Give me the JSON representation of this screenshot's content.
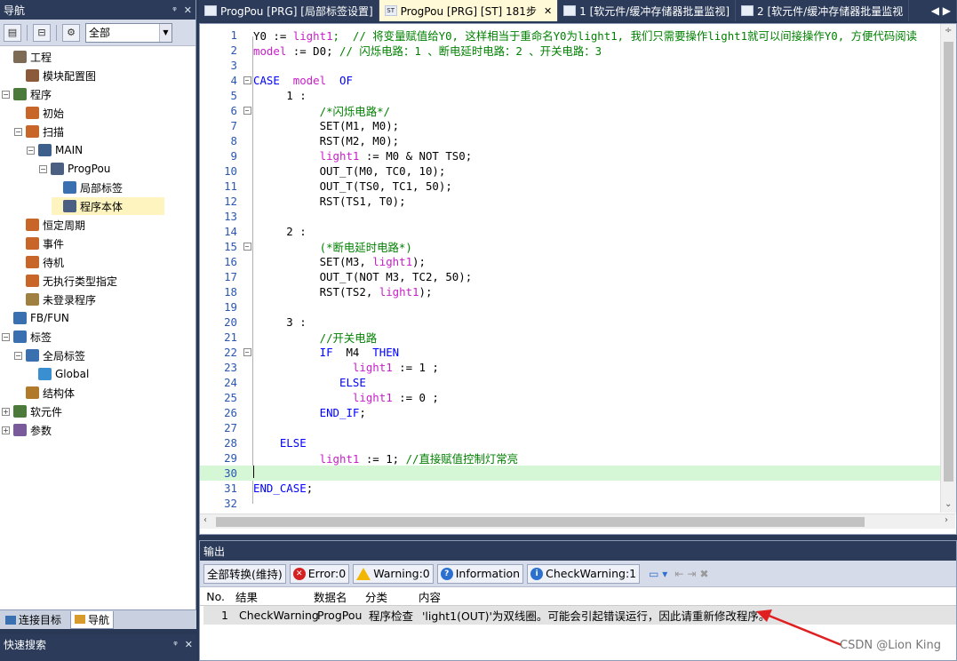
{
  "nav": {
    "title": "导航",
    "pin": "ᵠ",
    "close": "✕",
    "filter_value": "全部",
    "tree": [
      {
        "label": "工程",
        "indent": 0,
        "toggle": "",
        "icon": "project-icon",
        "iconColor": "#7d6b55"
      },
      {
        "label": "模块配置图",
        "indent": 1,
        "toggle": "",
        "icon": "module-config-icon",
        "iconColor": "#8a5a3a"
      },
      {
        "label": "程序",
        "indent": 0,
        "toggle": "−",
        "icon": "program-folder-icon",
        "iconColor": "#4b7a3a"
      },
      {
        "label": "初始",
        "indent": 1,
        "toggle": "",
        "icon": "program-icon",
        "iconColor": "#c8662a"
      },
      {
        "label": "扫描",
        "indent": 1,
        "toggle": "−",
        "icon": "program-icon",
        "iconColor": "#c8662a"
      },
      {
        "label": "MAIN",
        "indent": 2,
        "toggle": "−",
        "icon": "main-icon",
        "iconColor": "#3c5f8c"
      },
      {
        "label": "ProgPou",
        "indent": 3,
        "toggle": "−",
        "icon": "st-icon",
        "iconColor": "#4a5f82"
      },
      {
        "label": "局部标签",
        "indent": 4,
        "toggle": "",
        "icon": "local-label-icon",
        "iconColor": "#3a6fb0"
      },
      {
        "label": "程序本体",
        "indent": 4,
        "toggle": "",
        "icon": "st-body-icon",
        "iconColor": "#4a5f82"
      },
      {
        "label": "恒定周期",
        "indent": 1,
        "toggle": "",
        "icon": "program-icon",
        "iconColor": "#c8662a"
      },
      {
        "label": "事件",
        "indent": 1,
        "toggle": "",
        "icon": "program-icon",
        "iconColor": "#c8662a"
      },
      {
        "label": "待机",
        "indent": 1,
        "toggle": "",
        "icon": "program-icon",
        "iconColor": "#c8662a"
      },
      {
        "label": "无执行类型指定",
        "indent": 1,
        "toggle": "",
        "icon": "program-icon",
        "iconColor": "#c8662a"
      },
      {
        "label": "未登录程序",
        "indent": 1,
        "toggle": "",
        "icon": "unregistered-icon",
        "iconColor": "#a08040"
      },
      {
        "label": "FB/FUN",
        "indent": 0,
        "toggle": "",
        "icon": "fbfun-icon",
        "iconColor": "#3a6fb0"
      },
      {
        "label": "标签",
        "indent": 0,
        "toggle": "−",
        "icon": "label-folder-icon",
        "iconColor": "#3a6fb0"
      },
      {
        "label": "全局标签",
        "indent": 1,
        "toggle": "−",
        "icon": "global-label-icon",
        "iconColor": "#3a6fb0"
      },
      {
        "label": "Global",
        "indent": 2,
        "toggle": "",
        "icon": "global-icon",
        "iconColor": "#3a8fd0"
      },
      {
        "label": "结构体",
        "indent": 1,
        "toggle": "",
        "icon": "struct-icon",
        "iconColor": "#b07a2a"
      },
      {
        "label": "软元件",
        "indent": 0,
        "toggle": "+",
        "icon": "device-icon",
        "iconColor": "#4b7a3a"
      },
      {
        "label": "参数",
        "indent": 0,
        "toggle": "+",
        "icon": "parameter-icon",
        "iconColor": "#7a5a9a"
      }
    ],
    "selected_index": 8,
    "bottom_tabs": [
      "连接目标",
      "导航"
    ],
    "quick_search": "快速搜索"
  },
  "tabs": [
    {
      "label": "ProgPou [PRG] [局部标签设置]",
      "icon": "local-label-icon",
      "active": false,
      "close": false
    },
    {
      "label": "ProgPou [PRG] [ST] 181步",
      "icon": "st-icon",
      "active": true,
      "close": true
    },
    {
      "label": "1 [软元件/缓冲存储器批量监视]",
      "icon": "monitor-icon",
      "active": false,
      "close": false
    },
    {
      "label": "2 [软元件/缓冲存储器批量监视",
      "icon": "monitor-icon",
      "active": false,
      "close": false
    }
  ],
  "tab_scroll": "◀ ▶",
  "editor": {
    "highlight_line": 30,
    "lines": [
      {
        "n": "1",
        "fold": "",
        "parts": [
          [
            "Y0 := ",
            ""
          ],
          [
            "light1",
            "var"
          ],
          [
            ";  // 将变量赋值给Y0, 这样相当于重命名Y0为light1, 我们只需要操作light1就可以间接操作Y0, 方便代码阅读",
            "cm"
          ]
        ]
      },
      {
        "n": "2",
        "fold": "",
        "parts": [
          [
            "model",
            "var"
          ],
          [
            " := D0; ",
            ""
          ],
          [
            "// 闪烁电路：1 、断电延时电路：2 、开关电路：3",
            "cm"
          ]
        ]
      },
      {
        "n": "3",
        "fold": "",
        "parts": []
      },
      {
        "n": "4",
        "fold": "−",
        "parts": [
          [
            "CASE",
            "kw"
          ],
          [
            "  ",
            ""
          ],
          [
            "model",
            "var"
          ],
          [
            "  ",
            ""
          ],
          [
            "OF",
            "kw"
          ]
        ]
      },
      {
        "n": "5",
        "fold": "",
        "parts": [
          [
            "     1 :",
            ""
          ]
        ]
      },
      {
        "n": "6",
        "fold": "−",
        "parts": [
          [
            "          ",
            ""
          ],
          [
            "/*闪烁电路*/",
            "cm"
          ]
        ]
      },
      {
        "n": "7",
        "fold": "",
        "parts": [
          [
            "          SET(M1, M0);",
            ""
          ]
        ]
      },
      {
        "n": "8",
        "fold": "",
        "parts": [
          [
            "          RST(M2, M0);",
            ""
          ]
        ]
      },
      {
        "n": "9",
        "fold": "",
        "parts": [
          [
            "          ",
            ""
          ],
          [
            "light1",
            "var"
          ],
          [
            " := M0 & NOT TS0;",
            ""
          ]
        ]
      },
      {
        "n": "10",
        "fold": "",
        "parts": [
          [
            "          OUT_T(M0, TC0, 10);",
            ""
          ]
        ]
      },
      {
        "n": "11",
        "fold": "",
        "parts": [
          [
            "          OUT_T(TS0, TC1, 50);",
            ""
          ]
        ]
      },
      {
        "n": "12",
        "fold": "",
        "parts": [
          [
            "          RST(TS1, T0);",
            ""
          ]
        ]
      },
      {
        "n": "13",
        "fold": "",
        "parts": []
      },
      {
        "n": "14",
        "fold": "",
        "parts": [
          [
            "     2 :",
            ""
          ]
        ]
      },
      {
        "n": "15",
        "fold": "−",
        "parts": [
          [
            "          ",
            ""
          ],
          [
            "(*断电延时电路*)",
            "cm"
          ]
        ]
      },
      {
        "n": "16",
        "fold": "",
        "parts": [
          [
            "          SET(M3, ",
            ""
          ],
          [
            "light1",
            "var"
          ],
          [
            ");",
            ""
          ]
        ]
      },
      {
        "n": "17",
        "fold": "",
        "parts": [
          [
            "          OUT_T(NOT M3, TC2, 50);",
            ""
          ]
        ]
      },
      {
        "n": "18",
        "fold": "",
        "parts": [
          [
            "          RST(TS2, ",
            ""
          ],
          [
            "light1",
            "var"
          ],
          [
            ");",
            ""
          ]
        ]
      },
      {
        "n": "19",
        "fold": "",
        "parts": []
      },
      {
        "n": "20",
        "fold": "",
        "parts": [
          [
            "     3 :",
            ""
          ]
        ]
      },
      {
        "n": "21",
        "fold": "",
        "parts": [
          [
            "          ",
            ""
          ],
          [
            "//开关电路",
            "cm"
          ]
        ]
      },
      {
        "n": "22",
        "fold": "−",
        "parts": [
          [
            "          ",
            ""
          ],
          [
            "IF",
            "kw"
          ],
          [
            "  M4  ",
            ""
          ],
          [
            "THEN",
            "kw"
          ]
        ]
      },
      {
        "n": "23",
        "fold": "",
        "parts": [
          [
            "               ",
            ""
          ],
          [
            "light1",
            "var"
          ],
          [
            " := 1 ;",
            ""
          ]
        ]
      },
      {
        "n": "24",
        "fold": "",
        "parts": [
          [
            "             ",
            ""
          ],
          [
            "ELSE",
            "kw"
          ]
        ]
      },
      {
        "n": "25",
        "fold": "",
        "parts": [
          [
            "               ",
            ""
          ],
          [
            "light1",
            "var"
          ],
          [
            " := 0 ;",
            ""
          ]
        ]
      },
      {
        "n": "26",
        "fold": "",
        "parts": [
          [
            "          ",
            ""
          ],
          [
            "END_IF",
            "kw"
          ],
          [
            ";",
            ""
          ]
        ]
      },
      {
        "n": "27",
        "fold": "",
        "parts": []
      },
      {
        "n": "28",
        "fold": "",
        "parts": [
          [
            "    ",
            ""
          ],
          [
            "ELSE",
            "kw"
          ]
        ]
      },
      {
        "n": "29",
        "fold": "",
        "parts": [
          [
            "          ",
            ""
          ],
          [
            "light1",
            "var"
          ],
          [
            " := 1; ",
            ""
          ],
          [
            "//直接赋值控制灯常亮",
            "cm"
          ]
        ]
      },
      {
        "n": "30",
        "fold": "",
        "parts": []
      },
      {
        "n": "31",
        "fold": "",
        "parts": [
          [
            "END_CASE",
            "kw"
          ],
          [
            ";",
            ""
          ]
        ]
      },
      {
        "n": "32",
        "fold": "",
        "parts": []
      }
    ]
  },
  "output": {
    "title": "输出",
    "convert_all": "全部转换(维持)",
    "error": "Error:0",
    "warning": "Warning:0",
    "information": "Information",
    "check_warning": "CheckWarning:1",
    "columns": [
      "No.",
      "结果",
      "数据名",
      "分类",
      "内容"
    ],
    "rows": [
      {
        "no": "1",
        "result": "CheckWarning",
        "data_name": "ProgPou",
        "category": "程序检查",
        "content": "'light1(OUT)'为双线圈。可能会引起错误运行，因此请重新修改程序。"
      }
    ]
  },
  "watermark": "CSDN @Lion King"
}
